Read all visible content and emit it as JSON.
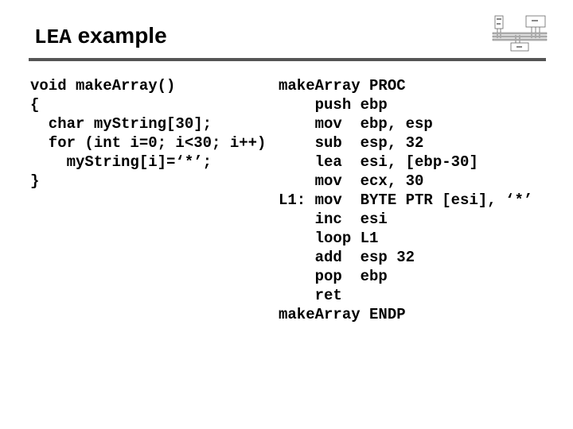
{
  "slide": {
    "title_mono": "LEA",
    "title_rest": " example",
    "thumbnail_icon": "computer-architecture-diagram-icon"
  },
  "c_code": {
    "lines": [
      "void makeArray()",
      "{",
      "  char myString[30];",
      "  for (int i=0; i<30; i++)",
      "    myString[i]=‘*’;",
      "}"
    ]
  },
  "asm_code": {
    "lines": [
      "makeArray PROC",
      "    push ebp",
      "    mov  ebp, esp",
      "    sub  esp, 32",
      "    lea  esi, [ebp-30]",
      "    mov  ecx, 30",
      "L1: mov  BYTE PTR [esi], ‘*’",
      "    inc  esi",
      "    loop L1",
      "    add  esp 32",
      "    pop  ebp",
      "    ret",
      "makeArray ENDP"
    ]
  }
}
